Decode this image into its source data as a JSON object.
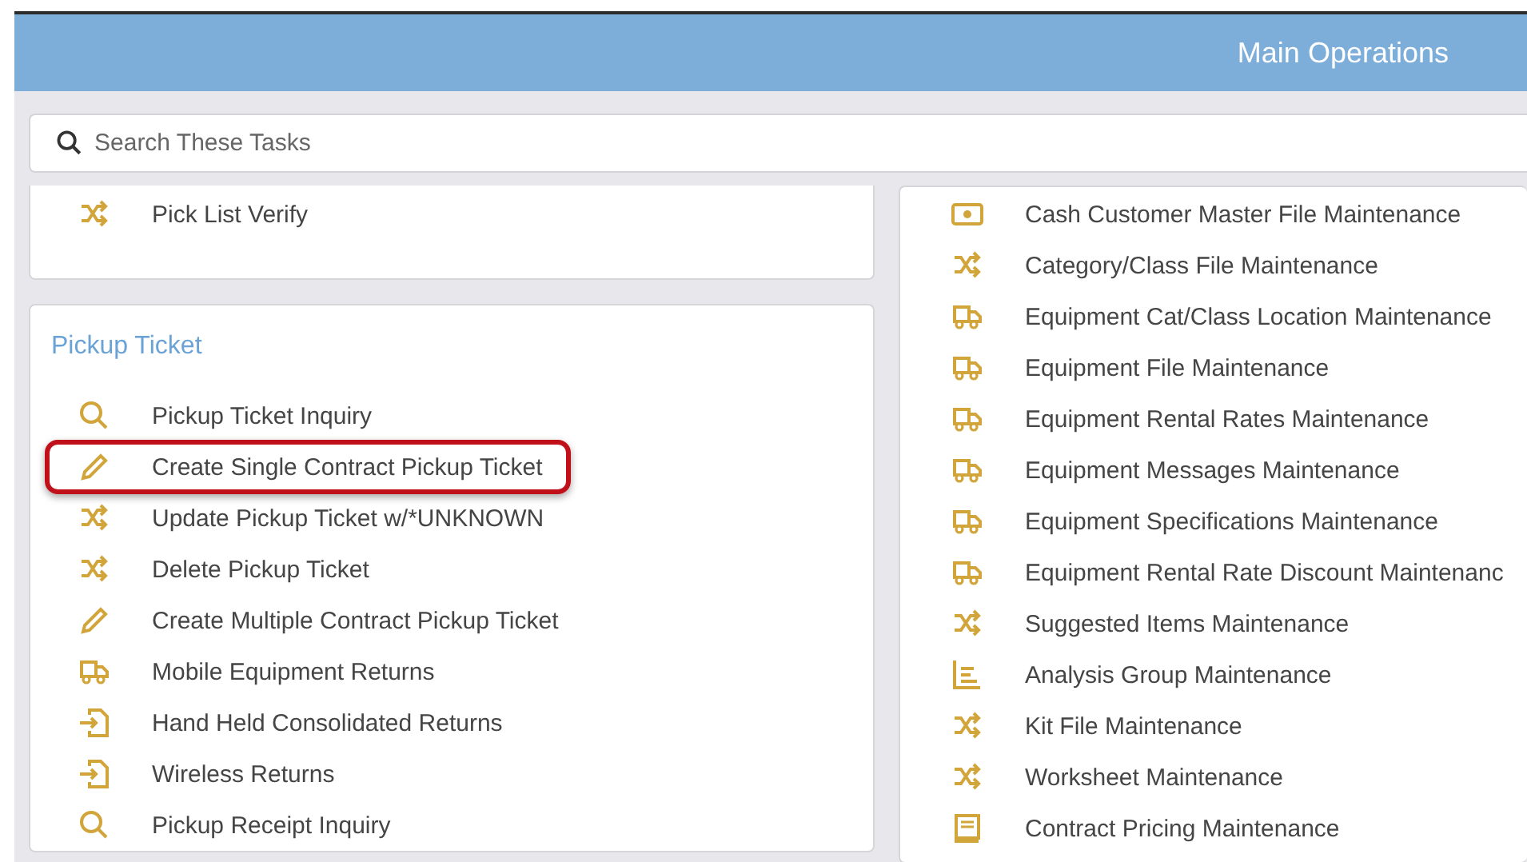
{
  "header": {
    "title": "Main Operations"
  },
  "search": {
    "placeholder": "Search These Tasks"
  },
  "left_cards": [
    {
      "items": [
        {
          "kind": "shuffle",
          "label": "Pick List Verify",
          "highlighted": false
        }
      ]
    },
    {
      "title": "Pickup Ticket",
      "items": [
        {
          "kind": "search",
          "label": "Pickup Ticket Inquiry",
          "highlighted": false
        },
        {
          "kind": "pencil",
          "label": "Create Single Contract Pickup Ticket",
          "highlighted": true
        },
        {
          "kind": "shuffle",
          "label": "Update Pickup Ticket w/*UNKNOWN",
          "highlighted": false
        },
        {
          "kind": "shuffle",
          "label": "Delete Pickup Ticket",
          "highlighted": false
        },
        {
          "kind": "pencil",
          "label": "Create Multiple Contract Pickup Ticket",
          "highlighted": false
        },
        {
          "kind": "truck",
          "label": "Mobile Equipment Returns",
          "highlighted": false
        },
        {
          "kind": "enter",
          "label": "Hand Held Consolidated Returns",
          "highlighted": false
        },
        {
          "kind": "enter",
          "label": "Wireless Returns",
          "highlighted": false
        },
        {
          "kind": "search",
          "label": "Pickup Receipt Inquiry",
          "highlighted": false
        }
      ]
    }
  ],
  "right_card": {
    "items": [
      {
        "kind": "cash",
        "label": "Cash Customer Master File Maintenance"
      },
      {
        "kind": "shuffle",
        "label": "Category/Class File Maintenance"
      },
      {
        "kind": "truck",
        "label": "Equipment Cat/Class Location Maintenance"
      },
      {
        "kind": "truck",
        "label": "Equipment File Maintenance"
      },
      {
        "kind": "truck",
        "label": "Equipment Rental Rates Maintenance"
      },
      {
        "kind": "truck",
        "label": "Equipment Messages Maintenance"
      },
      {
        "kind": "truck",
        "label": "Equipment Specifications Maintenance"
      },
      {
        "kind": "truck",
        "label": "Equipment Rental Rate Discount Maintenanc"
      },
      {
        "kind": "shuffle",
        "label": "Suggested Items Maintenance"
      },
      {
        "kind": "chart",
        "label": "Analysis Group Maintenance"
      },
      {
        "kind": "shuffle",
        "label": "Kit File Maintenance"
      },
      {
        "kind": "shuffle",
        "label": "Worksheet Maintenance"
      },
      {
        "kind": "book",
        "label": "Contract Pricing Maintenance"
      }
    ]
  }
}
